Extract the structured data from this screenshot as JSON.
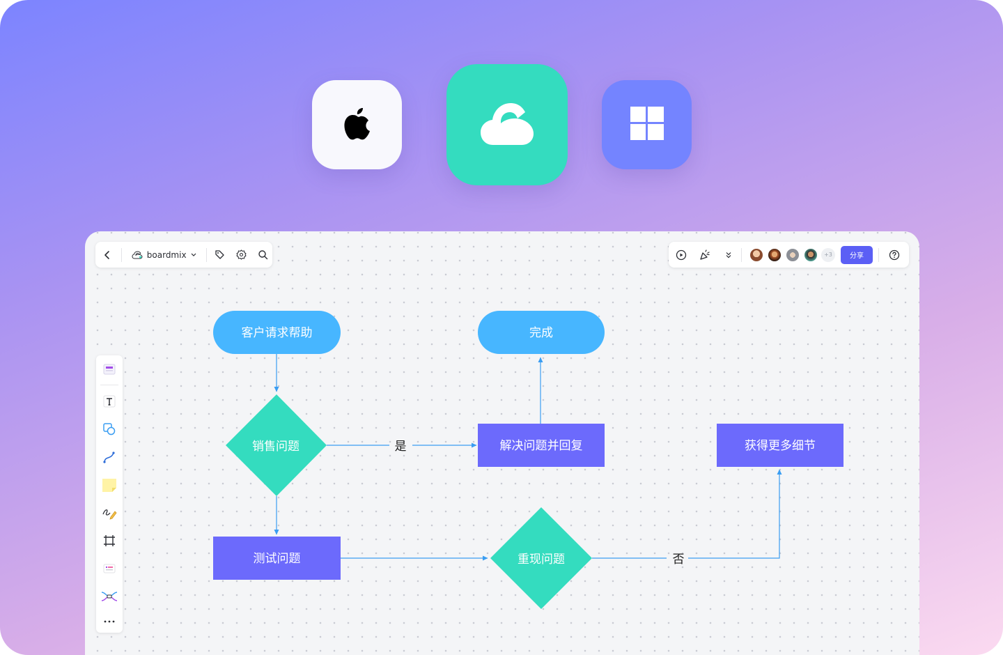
{
  "app_icons": [
    {
      "name": "apple-icon",
      "platform": "macOS"
    },
    {
      "name": "cloud-icon",
      "platform": "web"
    },
    {
      "name": "windows-icon",
      "platform": "Windows"
    }
  ],
  "toolbar": {
    "board_name": "boardmix",
    "collaborators_more": "+3",
    "share_label": "分享"
  },
  "flowchart": {
    "nodes": {
      "start": "客户请求帮助",
      "done": "完成",
      "sales_q": "销售问题",
      "resolve": "解决问题并回复",
      "details": "获得更多细节",
      "test": "测试问题",
      "reproduce": "重现问题"
    },
    "edge_labels": {
      "yes": "是",
      "no": "否"
    }
  },
  "colors": {
    "terminal": "#47b6ff",
    "process": "#6c6afc",
    "decision": "#34dcbf",
    "arrow": "#3a9df2",
    "share": "#5b5ff5"
  }
}
